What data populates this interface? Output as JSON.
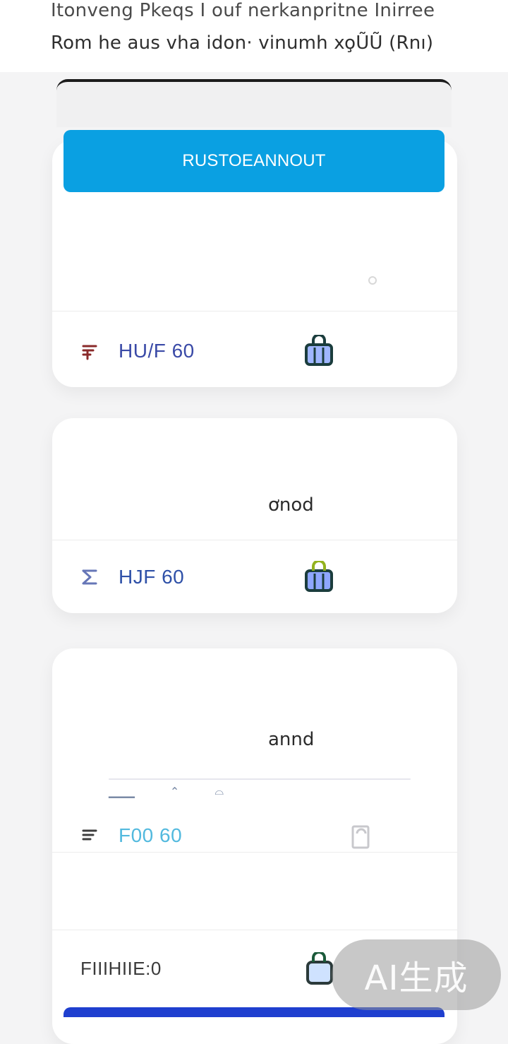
{
  "header": {
    "line1": "Itonveng Pkeqs I ouf nerkanpritne Inirree",
    "line2": "Rom he aus vha idon· vinumh xo̧ŨŨ (Rnı)"
  },
  "primary_button": {
    "label": "RUSTOEANNOUT",
    "color": "#0aa0e2"
  },
  "cards": [
    {
      "price": "HU/F 60",
      "price_color": "#3a4aa7",
      "icon_name": "strike-icon",
      "bag_icon": "shopping-bag-icon",
      "text": ""
    },
    {
      "text": "ơnod",
      "price": "HJF 60",
      "price_color": "#2f51a8",
      "icon_name": "sigma-icon",
      "bag_icon": "shopping-bag-icon"
    },
    {
      "text": "annd",
      "price": "F00 60",
      "price_color": "#52b9de",
      "icon_name": "mark-icon",
      "bag_icon": "bag-outline-icon",
      "extra_row_text": "FIIIHIIE:0"
    }
  ],
  "watermark": {
    "label": "AI生成"
  },
  "colors": {
    "background": "#f4f4f5",
    "card": "#ffffff",
    "divider": "#ececec",
    "bottom_bar": "#1f3fcf"
  }
}
